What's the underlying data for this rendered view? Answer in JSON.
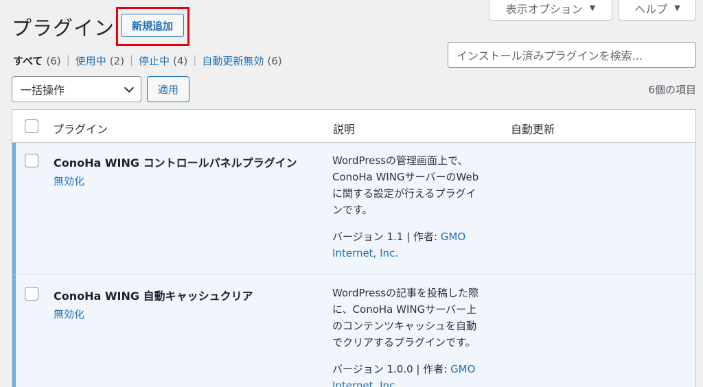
{
  "screen_meta": {
    "display_options": "表示オプション",
    "help": "ヘルプ",
    "arrow": "▼"
  },
  "page": {
    "title": "プラグイン",
    "add_new": "新規追加"
  },
  "filters": [
    {
      "label": "すべて",
      "count": "(6)",
      "current": true
    },
    {
      "label": "使用中",
      "count": "(2)",
      "current": false
    },
    {
      "label": "停止中",
      "count": "(4)",
      "current": false
    },
    {
      "label": "自動更新無効",
      "count": "(6)",
      "current": false
    }
  ],
  "filter_separator": "|",
  "search": {
    "placeholder": "インストール済みプラグインを検索..."
  },
  "bulk": {
    "selected": "一括操作",
    "apply": "適用"
  },
  "items_count": "6個の項目",
  "table": {
    "headers": {
      "plugin": "プラグイン",
      "description": "説明",
      "auto_update": "自動更新"
    },
    "rows": [
      {
        "name": "ConoHa WING コントロールパネルプラグイン",
        "action": "無効化",
        "description": [
          "WordPressの管理画面上で、",
          "ConoHa WINGサーバーのWeb",
          "に関する設定が行えるプラグイ",
          "ンです。"
        ],
        "version_text": "バージョン 1.1 | 作者: ",
        "author_line1": "GMO",
        "author_line2": "Internet, Inc."
      },
      {
        "name": "ConoHa WING 自動キャッシュクリア",
        "action": "無効化",
        "description": [
          "WordPressの記事を投稿した際",
          "に、ConoHa WINGサーバー上",
          "のコンテンツキャッシュを自動",
          "でクリアするプラグインです。"
        ],
        "version_text": "バージョン 1.0.0 | 作者: ",
        "author_line1": "GMO",
        "author_line2": "Internet, Inc."
      }
    ]
  },
  "colors": {
    "accent": "#2271b1",
    "active_row_bg": "#f0f6fc",
    "active_row_border": "#72aee6",
    "highlight_box": "#e3000f"
  }
}
